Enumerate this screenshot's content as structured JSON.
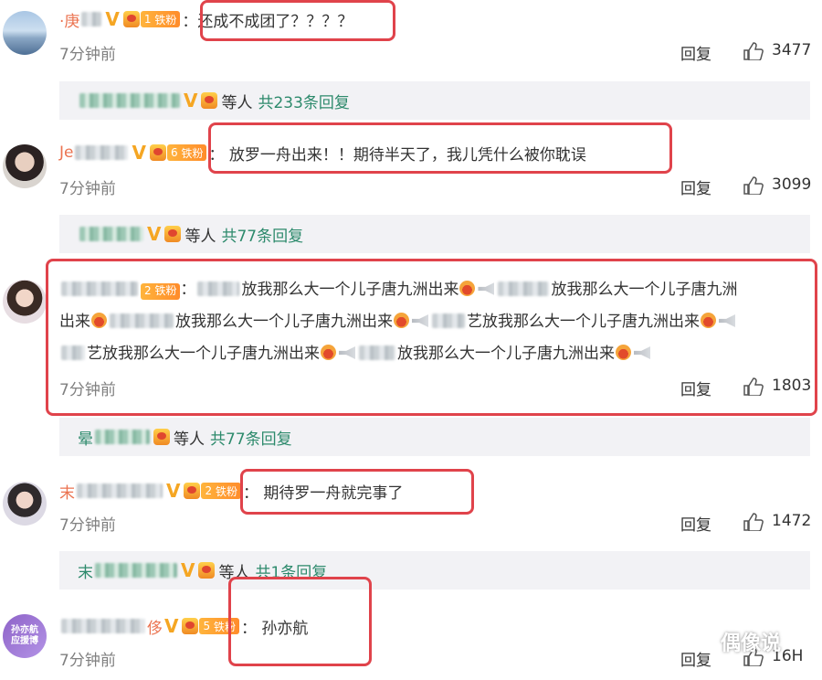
{
  "comments": [
    {
      "username_visible": "·庚",
      "badge_level": "1",
      "fan_label": "铁粉",
      "text": "还成不成团了？？？？",
      "time": "7分钟前",
      "reply_label": "回复",
      "likes": "3477",
      "replies_summary": {
        "others": "等人",
        "total": "共233条回复"
      }
    },
    {
      "username_visible": "Je",
      "badge_level": "6",
      "fan_label": "铁粉",
      "text": "放罗一舟出来！！期待半天了，我儿凭什么被你耽误",
      "time": "7分钟前",
      "reply_label": "回复",
      "likes": "3099",
      "replies_summary": {
        "others": "等人",
        "total": "共77条回复"
      }
    },
    {
      "badge_level": "2",
      "fan_label": "铁粉",
      "line1_a": "放我那么大一个儿子唐九洲出来",
      "line1_b": "放我那么大一个儿子唐九洲",
      "line2_a": "出来",
      "line2_b": "放我那么大一个儿子唐九洲出来",
      "line2_c": "艺放我那么大一个儿子唐九洲出来",
      "line3_a": "艺放我那么大一个儿子唐九洲出来",
      "line3_b": "放我那么大一个儿子唐九洲出来",
      "time": "7分钟前",
      "reply_label": "回复",
      "likes": "1803",
      "replies_summary": {
        "first": "晕",
        "others": "等人",
        "total": "共77条回复"
      }
    },
    {
      "username_visible": "末",
      "badge_level": "2",
      "fan_label": "铁粉",
      "text": "期待罗一舟就完事了",
      "time": "7分钟前",
      "reply_label": "回复",
      "likes": "1472",
      "replies_summary": {
        "first": "末",
        "others": "等人",
        "total": "共1条回复"
      }
    },
    {
      "username_visible": "侈",
      "badge_level": "5",
      "fan_label": "铁粉",
      "text": "孙亦航",
      "time": "7分钟前",
      "reply_label": "回复",
      "likes": "16H",
      "avatar_text": [
        "孙亦航",
        "应援博"
      ]
    }
  ],
  "watermark": "偶像说",
  "colors": {
    "username": "#eb7350",
    "reply_total": "#2d8a6c",
    "highlight_box": "#e0434b",
    "reply_bar_bg": "#f2f2f5"
  }
}
